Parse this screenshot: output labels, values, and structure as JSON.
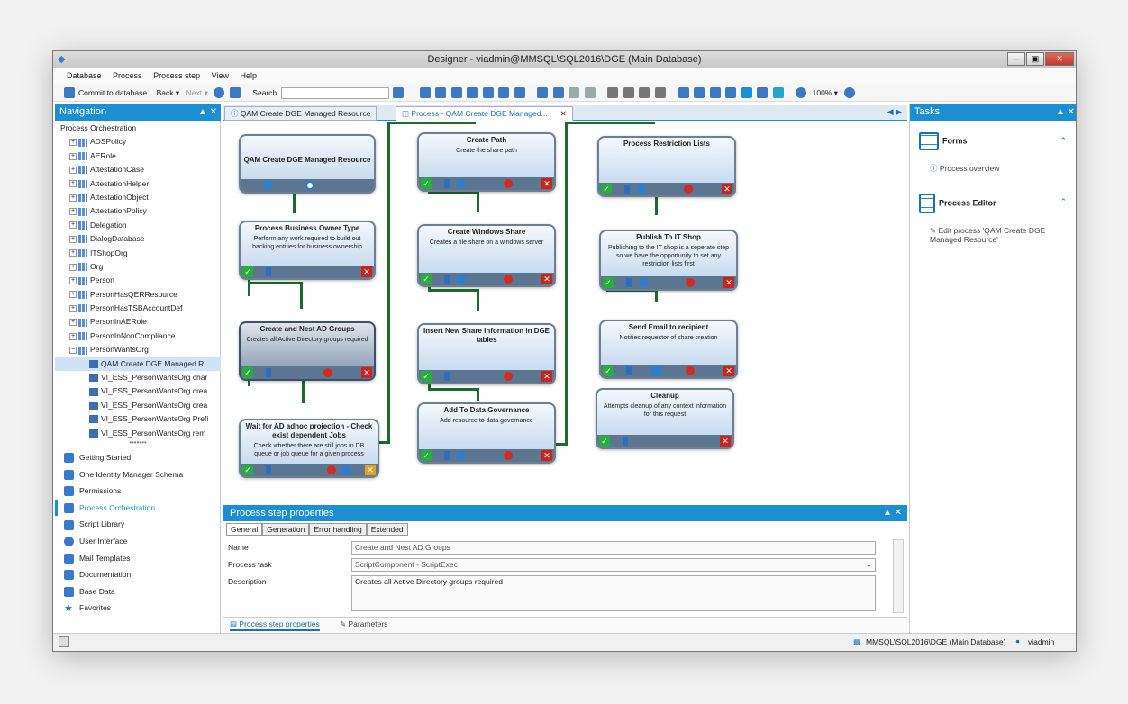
{
  "window": {
    "title": "Designer - viadmin@MMSQL\\SQL2016\\DGE (Main Database)",
    "controls": [
      "‒",
      "▣",
      "✕"
    ]
  },
  "menu": [
    "Database",
    "Process",
    "Process step",
    "View",
    "Help"
  ],
  "toolbar": {
    "commit": "Commit to database",
    "back": "Back ▾",
    "next": "Next ▾",
    "search_label": "Search",
    "zoom": "100% ▾"
  },
  "navigation": {
    "header": "Navigation",
    "root": "Process Orchestration",
    "tree": [
      {
        "label": "ADSPolicy"
      },
      {
        "label": "AERole"
      },
      {
        "label": "AttestationCase"
      },
      {
        "label": "AttestationHelper"
      },
      {
        "label": "AttestationObject"
      },
      {
        "label": "AttestationPolicy"
      },
      {
        "label": "Delegation"
      },
      {
        "label": "DialogDatabase"
      },
      {
        "label": "ITShopOrg"
      },
      {
        "label": "Org"
      },
      {
        "label": "Person"
      },
      {
        "label": "PersonHasQERResource"
      },
      {
        "label": "PersonHasTSBAccountDef"
      },
      {
        "label": "PersonInAERole"
      },
      {
        "label": "PersonInNonCompliance"
      },
      {
        "label": "PersonWantsOrg"
      }
    ],
    "children": [
      {
        "label": "QAM Create DGE Managed R"
      },
      {
        "label": "VI_ESS_PersonWantsOrg char"
      },
      {
        "label": "VI_ESS_PersonWantsOrg crea"
      },
      {
        "label": "VI_ESS_PersonWantsOrg crea"
      },
      {
        "label": "VI_ESS_PersonWantsOrg Prefi"
      },
      {
        "label": "VI_ESS_PersonWantsOrg rem"
      }
    ],
    "items": [
      {
        "label": "Getting Started",
        "icon": "book-icon"
      },
      {
        "label": "One Identity Manager Schema",
        "icon": "schema-icon"
      },
      {
        "label": "Permissions",
        "icon": "permissions-icon"
      },
      {
        "label": "Process Orchestration",
        "icon": "process-icon",
        "active": true
      },
      {
        "label": "Script Library",
        "icon": "script-icon"
      },
      {
        "label": "User Interface",
        "icon": "ui-icon"
      },
      {
        "label": "Mail Templates",
        "icon": "mail-icon"
      },
      {
        "label": "Documentation",
        "icon": "doc-icon"
      },
      {
        "label": "Base Data",
        "icon": "base-data-icon"
      },
      {
        "label": "Favorites",
        "icon": "star-icon"
      }
    ]
  },
  "doc_tabs": [
    {
      "label": "QAM Create DGE Managed Resource"
    },
    {
      "label": "Process - QAM Create DGE Managed..."
    }
  ],
  "nodes": [
    {
      "title": "QAM Create DGE Managed Resource",
      "desc": ""
    },
    {
      "title": "Process Business Owner Type",
      "desc": "Perform any work required to build out backing entities for business ownership"
    },
    {
      "title": "Create and Nest AD Groups",
      "desc": "Creates all Active Directory groups required"
    },
    {
      "title": "Wait for AD adhoc projection - Check exist dependent Jobs",
      "desc": "Check whether there are still jobs in DB queue or job queue for a given process"
    },
    {
      "title": "Create Path",
      "desc": "Create the share path"
    },
    {
      "title": "Create Windows Share",
      "desc": "Creates a file share on a windows server"
    },
    {
      "title": "Insert New Share Information in DGE tables",
      "desc": ""
    },
    {
      "title": "Add To Data Governance",
      "desc": "Add resource to data governance"
    },
    {
      "title": "Process Restriction Lists",
      "desc": ""
    },
    {
      "title": "Publish To IT Shop",
      "desc": "Publishing to the IT shop is a seperate step so we have the opportunity to set any restriction lists first"
    },
    {
      "title": "Send Email to recipient",
      "desc": "Notifies requestor of share creation"
    },
    {
      "title": "Cleanup",
      "desc": "Attempts cleanup of any context information for this request"
    }
  ],
  "props": {
    "header": "Process step properties",
    "tabs": [
      "General",
      "Generation",
      "Error handling",
      "Extended"
    ],
    "name_label": "Name",
    "name_value": "Create and Nest AD Groups",
    "task_label": "Process task",
    "task_value": "ScriptComponent - ScriptExec",
    "desc_label": "Description",
    "desc_value": "Creates all Active Directory groups required",
    "bottom_tabs": [
      "Process step properties",
      "Parameters"
    ]
  },
  "tasks": {
    "header": "Tasks",
    "forms_label": "Forms",
    "process_overview": "Process overview",
    "editor_label": "Process Editor",
    "edit_process": "Edit process 'QAM Create DGE Managed Resource'"
  },
  "status": {
    "db": "MMSQL\\SQL2016\\DGE (Main Database)",
    "user": "viadmin"
  },
  "colors": {
    "accent": "#1c8fd1",
    "connector": "#1d6a2a"
  }
}
